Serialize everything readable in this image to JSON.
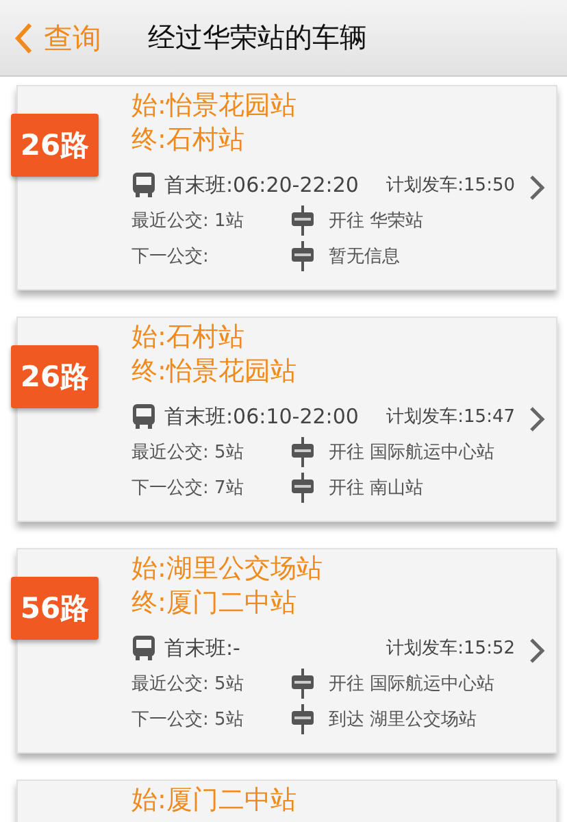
{
  "nav": {
    "back": "查询",
    "title": "经过华荣站的车辆"
  },
  "routes": [
    {
      "route": "26路",
      "start": "始:怡景花园站",
      "end": "终:石村站",
      "hours": "首末班:06:20-22:20",
      "planned": "计划发车:15:50",
      "buses": [
        {
          "label": "最近公交: 1站",
          "info": "开往 华荣站"
        },
        {
          "label": "下一公交:",
          "info": "暂无信息"
        }
      ]
    },
    {
      "route": "26路",
      "start": "始:石村站",
      "end": "终:怡景花园站",
      "hours": "首末班:06:10-22:00",
      "planned": "计划发车:15:47",
      "buses": [
        {
          "label": "最近公交: 5站",
          "info": "开往 国际航运中心站"
        },
        {
          "label": "下一公交: 7站",
          "info": "开往 南山站"
        }
      ]
    },
    {
      "route": "56路",
      "start": "始:湖里公交场站",
      "end": "终:厦门二中站",
      "hours": "首末班:-",
      "planned": "计划发车:15:52",
      "buses": [
        {
          "label": "最近公交: 5站",
          "info": "开往 国际航运中心站"
        },
        {
          "label": "下一公交: 5站",
          "info": "到达 湖里公交场站"
        }
      ]
    },
    {
      "start": "始:厦门二中站"
    }
  ]
}
